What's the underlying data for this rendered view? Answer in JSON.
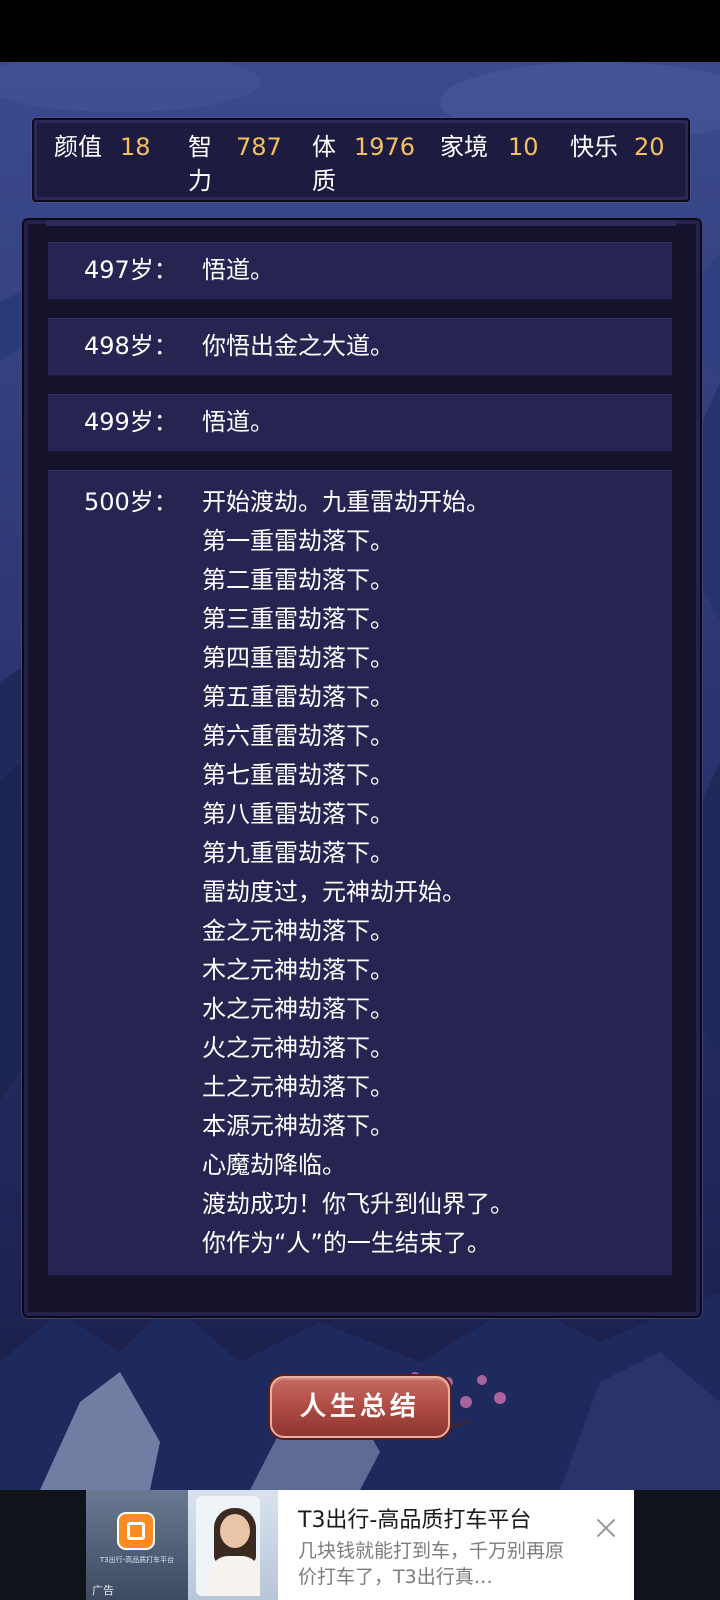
{
  "stats": [
    {
      "label": "颜值",
      "value": "18"
    },
    {
      "label": "智力",
      "value": "787"
    },
    {
      "label": "体质",
      "value": "1976"
    },
    {
      "label": "家境",
      "value": "10"
    },
    {
      "label": "快乐",
      "value": "20"
    }
  ],
  "log": [
    {
      "age": "497岁：",
      "lines": [
        "悟道。"
      ]
    },
    {
      "age": "498岁：",
      "lines": [
        "你悟出金之大道。"
      ]
    },
    {
      "age": "499岁：",
      "lines": [
        "悟道。"
      ]
    },
    {
      "age": "500岁：",
      "lines": [
        "开始渡劫。九重雷劫开始。",
        "第一重雷劫落下。",
        "第二重雷劫落下。",
        "第三重雷劫落下。",
        "第四重雷劫落下。",
        "第五重雷劫落下。",
        "第六重雷劫落下。",
        "第七重雷劫落下。",
        "第八重雷劫落下。",
        "第九重雷劫落下。",
        "雷劫度过，元神劫开始。",
        "金之元神劫落下。",
        "木之元神劫落下。",
        "水之元神劫落下。",
        "火之元神劫落下。",
        "土之元神劫落下。",
        "本源元神劫落下。",
        "心魔劫降临。",
        "渡劫成功！你飞升到仙界了。",
        "你作为“人”的一生结束了。"
      ]
    }
  ],
  "summary_button": "人生总结",
  "ad": {
    "title": "T3出行-高品质打车平台",
    "description": "几块钱就能打到车，千万别再原价打车了，T3出行真…",
    "tag": "广告",
    "small_text": "T3出行-高品质打车平台",
    "colors": {
      "brand": "#ff8a1f"
    }
  },
  "colors": {
    "stat_value": "#f2c15e",
    "panel": "#15132c",
    "entry": "#272451",
    "button": "#a8463f"
  }
}
